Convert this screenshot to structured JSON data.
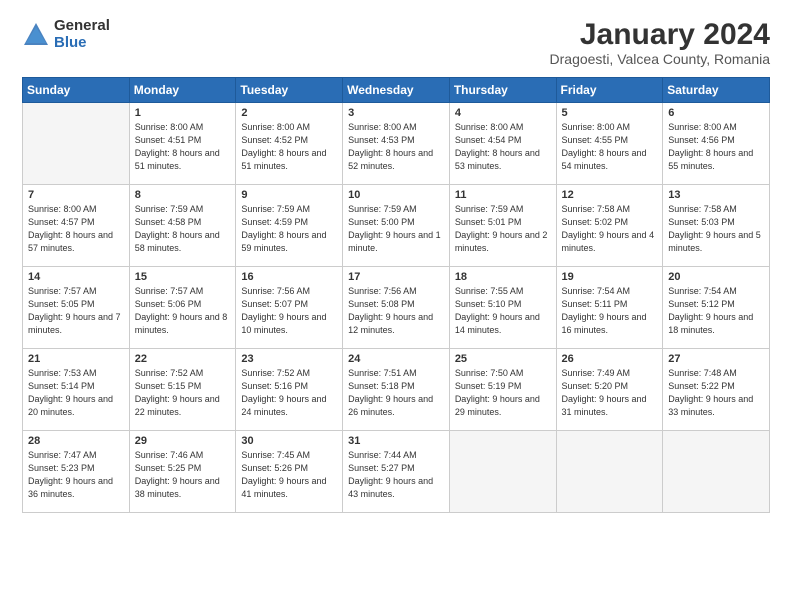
{
  "logo": {
    "general": "General",
    "blue": "Blue"
  },
  "title": "January 2024",
  "subtitle": "Dragoesti, Valcea County, Romania",
  "days_of_week": [
    "Sunday",
    "Monday",
    "Tuesday",
    "Wednesday",
    "Thursday",
    "Friday",
    "Saturday"
  ],
  "weeks": [
    [
      {
        "day": "",
        "empty": true
      },
      {
        "day": "1",
        "rise": "8:00 AM",
        "set": "4:51 PM",
        "daylight": "8 hours and 51 minutes."
      },
      {
        "day": "2",
        "rise": "8:00 AM",
        "set": "4:52 PM",
        "daylight": "8 hours and 51 minutes."
      },
      {
        "day": "3",
        "rise": "8:00 AM",
        "set": "4:53 PM",
        "daylight": "8 hours and 52 minutes."
      },
      {
        "day": "4",
        "rise": "8:00 AM",
        "set": "4:54 PM",
        "daylight": "8 hours and 53 minutes."
      },
      {
        "day": "5",
        "rise": "8:00 AM",
        "set": "4:55 PM",
        "daylight": "8 hours and 54 minutes."
      },
      {
        "day": "6",
        "rise": "8:00 AM",
        "set": "4:56 PM",
        "daylight": "8 hours and 55 minutes."
      }
    ],
    [
      {
        "day": "7",
        "rise": "8:00 AM",
        "set": "4:57 PM",
        "daylight": "8 hours and 57 minutes."
      },
      {
        "day": "8",
        "rise": "7:59 AM",
        "set": "4:58 PM",
        "daylight": "8 hours and 58 minutes."
      },
      {
        "day": "9",
        "rise": "7:59 AM",
        "set": "4:59 PM",
        "daylight": "8 hours and 59 minutes."
      },
      {
        "day": "10",
        "rise": "7:59 AM",
        "set": "5:00 PM",
        "daylight": "9 hours and 1 minute."
      },
      {
        "day": "11",
        "rise": "7:59 AM",
        "set": "5:01 PM",
        "daylight": "9 hours and 2 minutes."
      },
      {
        "day": "12",
        "rise": "7:58 AM",
        "set": "5:02 PM",
        "daylight": "9 hours and 4 minutes."
      },
      {
        "day": "13",
        "rise": "7:58 AM",
        "set": "5:03 PM",
        "daylight": "9 hours and 5 minutes."
      }
    ],
    [
      {
        "day": "14",
        "rise": "7:57 AM",
        "set": "5:05 PM",
        "daylight": "9 hours and 7 minutes."
      },
      {
        "day": "15",
        "rise": "7:57 AM",
        "set": "5:06 PM",
        "daylight": "9 hours and 8 minutes."
      },
      {
        "day": "16",
        "rise": "7:56 AM",
        "set": "5:07 PM",
        "daylight": "9 hours and 10 minutes."
      },
      {
        "day": "17",
        "rise": "7:56 AM",
        "set": "5:08 PM",
        "daylight": "9 hours and 12 minutes."
      },
      {
        "day": "18",
        "rise": "7:55 AM",
        "set": "5:10 PM",
        "daylight": "9 hours and 14 minutes."
      },
      {
        "day": "19",
        "rise": "7:54 AM",
        "set": "5:11 PM",
        "daylight": "9 hours and 16 minutes."
      },
      {
        "day": "20",
        "rise": "7:54 AM",
        "set": "5:12 PM",
        "daylight": "9 hours and 18 minutes."
      }
    ],
    [
      {
        "day": "21",
        "rise": "7:53 AM",
        "set": "5:14 PM",
        "daylight": "9 hours and 20 minutes."
      },
      {
        "day": "22",
        "rise": "7:52 AM",
        "set": "5:15 PM",
        "daylight": "9 hours and 22 minutes."
      },
      {
        "day": "23",
        "rise": "7:52 AM",
        "set": "5:16 PM",
        "daylight": "9 hours and 24 minutes."
      },
      {
        "day": "24",
        "rise": "7:51 AM",
        "set": "5:18 PM",
        "daylight": "9 hours and 26 minutes."
      },
      {
        "day": "25",
        "rise": "7:50 AM",
        "set": "5:19 PM",
        "daylight": "9 hours and 29 minutes."
      },
      {
        "day": "26",
        "rise": "7:49 AM",
        "set": "5:20 PM",
        "daylight": "9 hours and 31 minutes."
      },
      {
        "day": "27",
        "rise": "7:48 AM",
        "set": "5:22 PM",
        "daylight": "9 hours and 33 minutes."
      }
    ],
    [
      {
        "day": "28",
        "rise": "7:47 AM",
        "set": "5:23 PM",
        "daylight": "9 hours and 36 minutes."
      },
      {
        "day": "29",
        "rise": "7:46 AM",
        "set": "5:25 PM",
        "daylight": "9 hours and 38 minutes."
      },
      {
        "day": "30",
        "rise": "7:45 AM",
        "set": "5:26 PM",
        "daylight": "9 hours and 41 minutes."
      },
      {
        "day": "31",
        "rise": "7:44 AM",
        "set": "5:27 PM",
        "daylight": "9 hours and 43 minutes."
      },
      {
        "day": "",
        "empty": true
      },
      {
        "day": "",
        "empty": true
      },
      {
        "day": "",
        "empty": true
      }
    ]
  ]
}
